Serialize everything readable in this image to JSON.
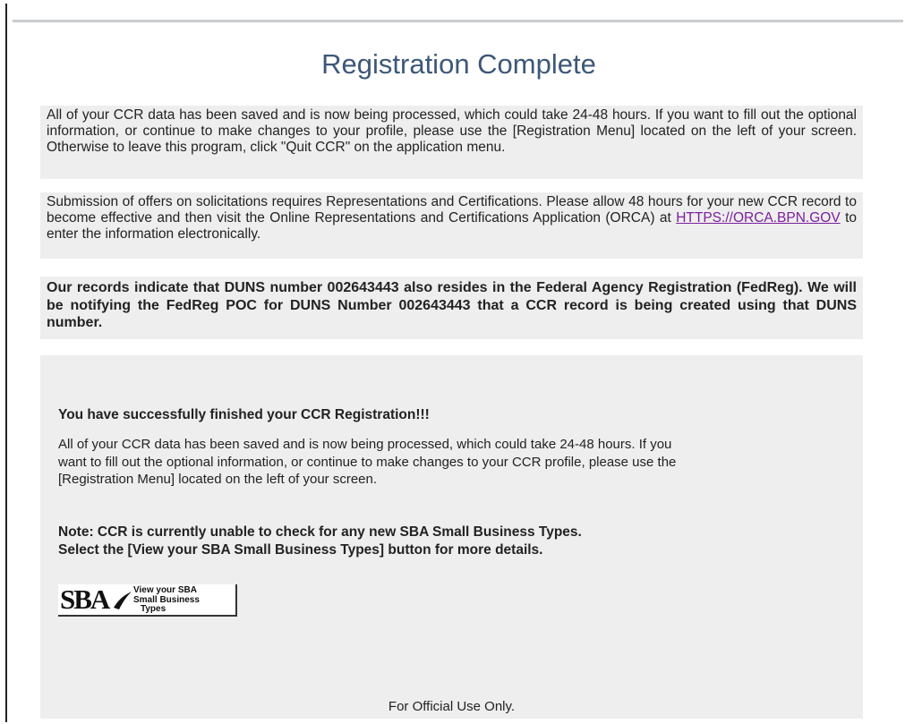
{
  "page": {
    "title": "Registration Complete"
  },
  "notices": {
    "saved": "All of your CCR data has been saved and is now being processed, which could take 24-48 hours.  If you want to fill out the optional information, or continue to make changes to your profile, please use the [Registration Menu] located on the left of your screen. Otherwise to leave this program, click \"Quit CCR\" on the application menu.",
    "reps_before_link": "Submission of offers on solicitations requires Representations and Certifications. Please allow 48 hours for your new CCR record to become effective and then visit the Online Representations and Certifications Application (ORCA) at ",
    "reps_link": "HTTPS://ORCA.BPN.GOV",
    "reps_after_link": " to enter the information electronically.",
    "duns": "Our records indicate that DUNS number 002643443 also resides in the Federal Agency Registration (FedReg). We will be notifying the FedReg POC for DUNS Number 002643443 that a CCR record is being created using that DUNS number."
  },
  "success": {
    "heading": "You have successfully finished your CCR Registration!!!",
    "body": "All of your CCR data has been saved and is now being processed, which could take 24-48 hours. If you want to fill out the optional information, or continue to make changes to your CCR profile, please use the [Registration Menu] located on the left of your screen.",
    "note_line1": "Note: CCR is currently unable to check for any new SBA Small Business Types.",
    "note_line2": "Select the [View your SBA Small Business Types] button for more details."
  },
  "sba_button": {
    "logo_text": "SBA",
    "caption_line1": "View your SBA",
    "caption_line2": "Small Business",
    "caption_line3": "Types"
  },
  "footer": {
    "text": "For Official Use Only."
  },
  "colors": {
    "title": "#3d5878",
    "panel_background": "#eeeeee",
    "link": "#7b1f9c"
  }
}
